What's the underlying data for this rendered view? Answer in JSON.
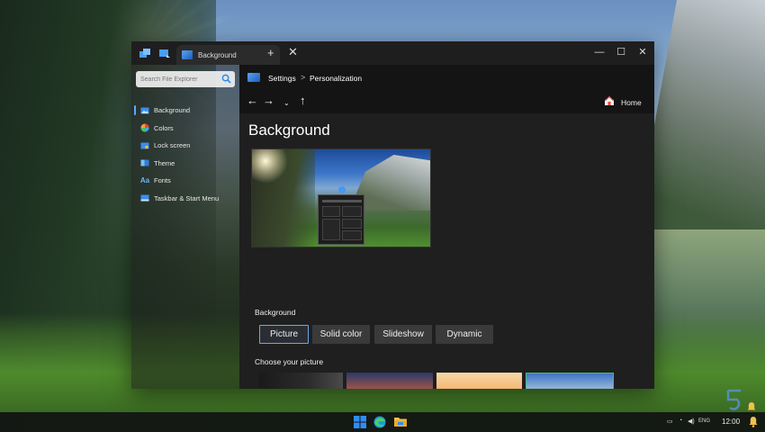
{
  "window": {
    "tab_label": "Background",
    "tab_add_icon": "+",
    "tab_close_icon": "✕",
    "minimize_icon": "—",
    "maximize_icon": "☐",
    "close_icon": "✕"
  },
  "sidebar": {
    "search_placeholder": "Search File Explorer",
    "items": [
      {
        "label": "Background",
        "icon": "picture-icon"
      },
      {
        "label": "Colors",
        "icon": "palette-icon"
      },
      {
        "label": "Lock screen",
        "icon": "lock-screen-icon"
      },
      {
        "label": "Theme",
        "icon": "theme-icon"
      },
      {
        "label": "Fonts",
        "icon": "fonts-icon",
        "glyph": "Aa"
      },
      {
        "label": "Taskbar & Start Menu",
        "icon": "taskbar-icon"
      }
    ]
  },
  "breadcrumb": {
    "root": "Settings",
    "separator": ">",
    "current": "Personalization"
  },
  "nav": {
    "back": "←",
    "forward": "→",
    "recent": "⌄",
    "up": "↑",
    "home_label": "Home"
  },
  "page": {
    "title": "Background",
    "background_label": "Background",
    "background_options": [
      "Picture",
      "Solid color",
      "Slideshow",
      "Dynamic"
    ],
    "selected_option": "Picture",
    "choose_picture_label": "Choose your picture",
    "selected_picture_index": 3
  },
  "taskbar": {
    "clock": "12:00",
    "lang": "ENG"
  },
  "colors": {
    "accent": "#5aa9ff",
    "selected_border": "#3fbf83"
  }
}
